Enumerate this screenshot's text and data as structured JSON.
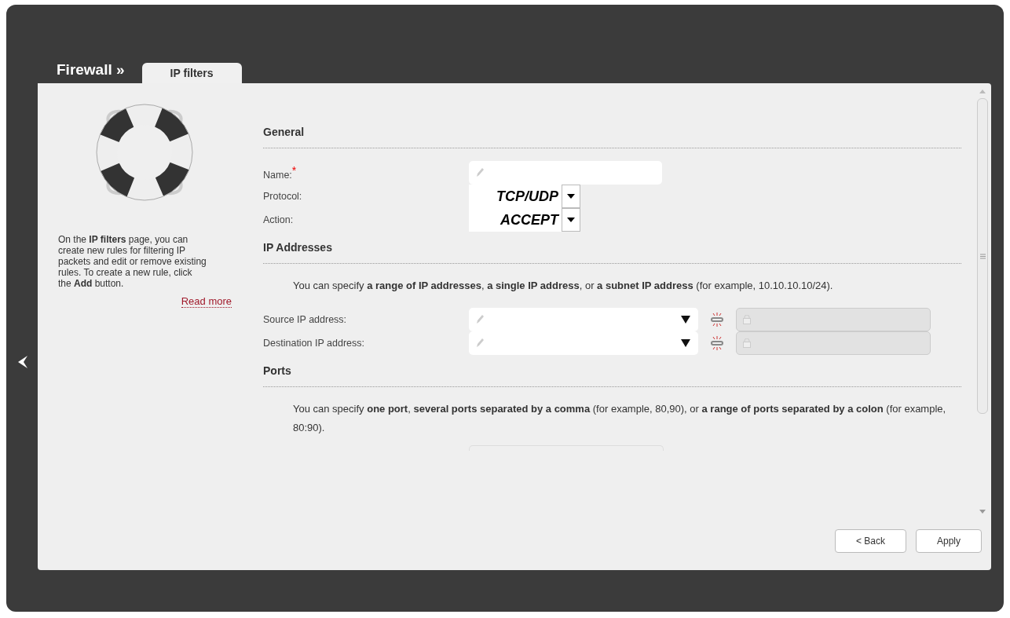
{
  "header": {
    "title": "Firewall »",
    "tabs": [
      {
        "label": "IP filters",
        "selected": true
      }
    ]
  },
  "sidebar": {
    "text": "On the **IP filters** page, you can create new rules for filtering IP packets and edit or remove existing rules. To create a new rule, click the **Add** button.",
    "link": "Read more"
  },
  "sections": [
    {
      "title": "General",
      "fields": [
        {
          "kind": "text",
          "label": "Name:",
          "required_mark": "*"
        },
        {
          "kind": "select",
          "label": "Protocol:",
          "value": "TCP/UDP"
        },
        {
          "kind": "select",
          "label": "Action:",
          "value": "ACCEPT"
        }
      ]
    },
    {
      "title": "IP Addresses",
      "note": "You can specify **a range of IP addresses**, **a single IP address**, or **a subnet IP address** (for example, 10.10.10.10/24).",
      "fields": [
        {
          "kind": "combo",
          "label": "Source IP address:"
        },
        {
          "kind": "combo",
          "label": "Destination IP address:"
        }
      ]
    },
    {
      "title": "Ports",
      "note": "You can specify **one port**, **several ports separated by a comma** (for example, 80,90), or **a range of ports separated by a colon** (for example, 80:90)."
    }
  ],
  "buttons": [
    "< Back",
    "Apply"
  ]
}
